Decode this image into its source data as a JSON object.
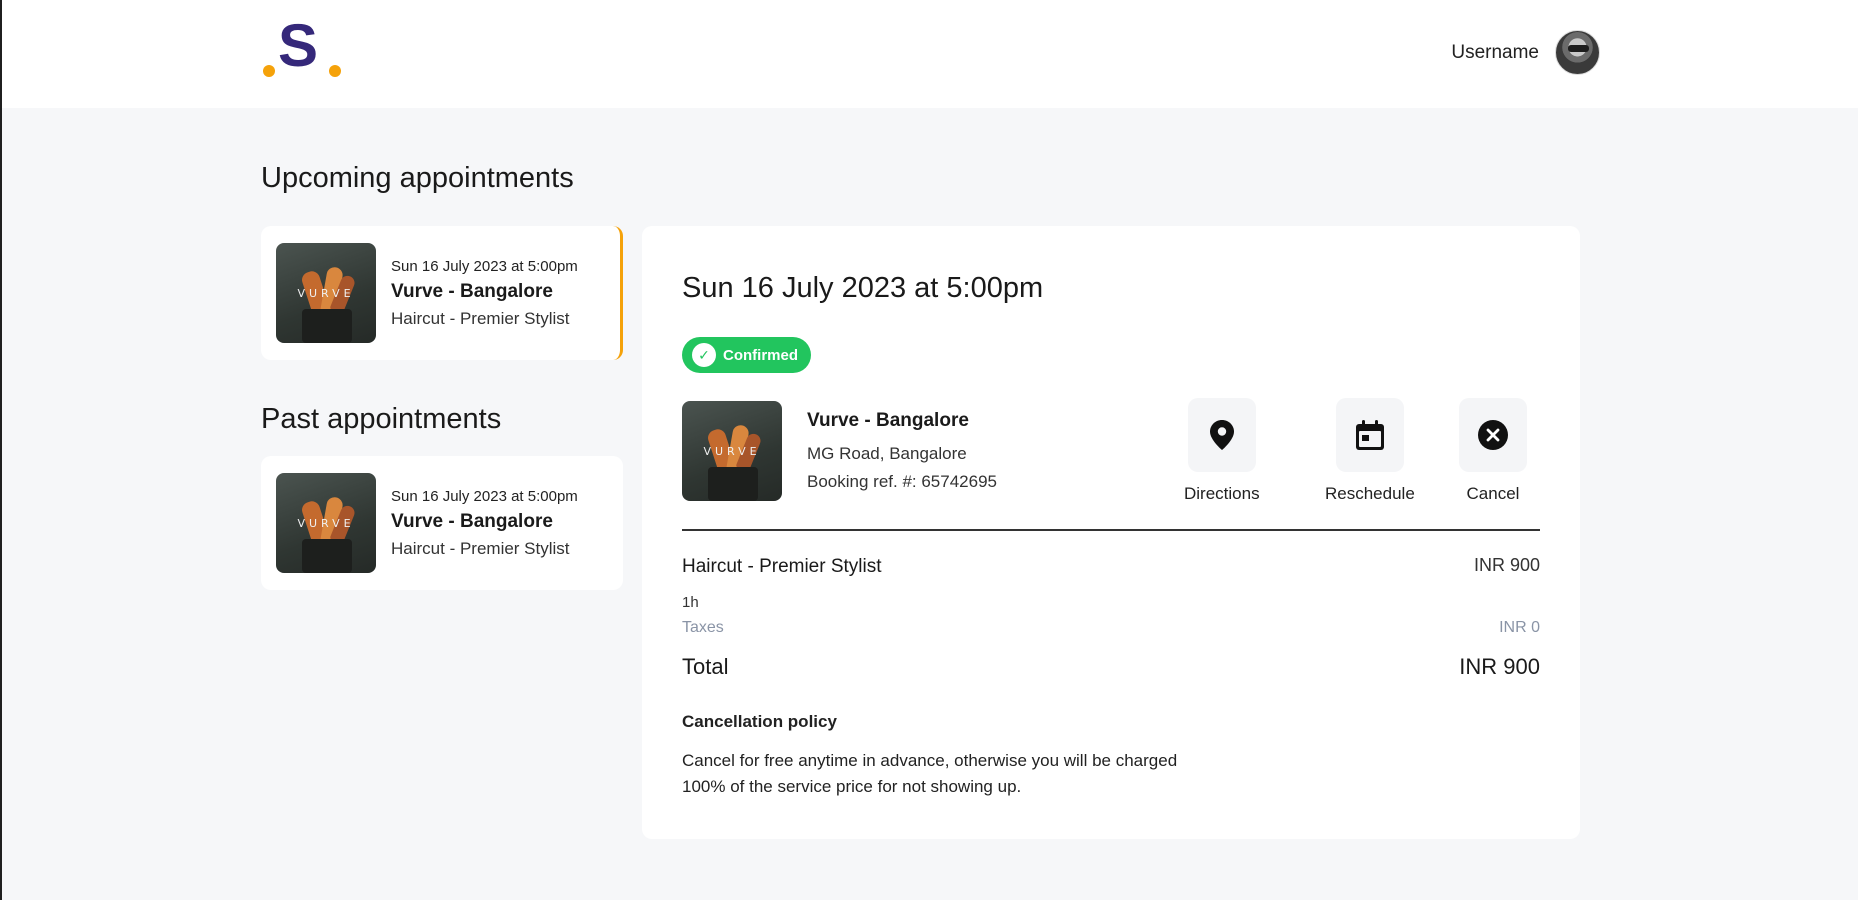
{
  "header": {
    "logo_text": "S",
    "username": "Username"
  },
  "sidebar": {
    "upcoming_title": "Upcoming appointments",
    "past_title": "Past appointments",
    "upcoming": [
      {
        "date": "Sun 16 July 2023 at 5:00pm",
        "venue": "Vurve - Bangalore",
        "service": "Haircut - Premier Stylist",
        "thumb_brand": "VURVE"
      }
    ],
    "past": [
      {
        "date": "Sun 16 July 2023 at 5:00pm",
        "venue": "Vurve - Bangalore",
        "service": "Haircut - Premier Stylist",
        "thumb_brand": "VURVE"
      }
    ]
  },
  "detail": {
    "title": "Sun 16 July 2023 at 5:00pm",
    "status": "Confirmed",
    "thumb_brand": "VURVE",
    "venue": "Vurve - Bangalore",
    "address": "MG Road, Bangalore",
    "booking_ref": "Booking ref. #: 65742695",
    "actions": {
      "directions": "Directions",
      "reschedule": "Reschedule",
      "cancel": "Cancel"
    },
    "service_name": "Haircut - Premier Stylist",
    "service_price": "INR 900",
    "duration": "1h",
    "taxes_label": "Taxes",
    "taxes_value": "INR 0",
    "total_label": "Total",
    "total_value": "INR 900",
    "policy_title": "Cancellation policy",
    "policy_text": "Cancel for free anytime in advance, otherwise you will be charged 100% of the service price for not showing up."
  },
  "colors": {
    "accent": "#f5a20a",
    "brand": "#35287a",
    "confirmed": "#22c55e",
    "background": "#f6f7f9"
  },
  "icons": [
    "location-pin-icon",
    "calendar-icon",
    "close-circle-icon",
    "check-icon"
  ]
}
